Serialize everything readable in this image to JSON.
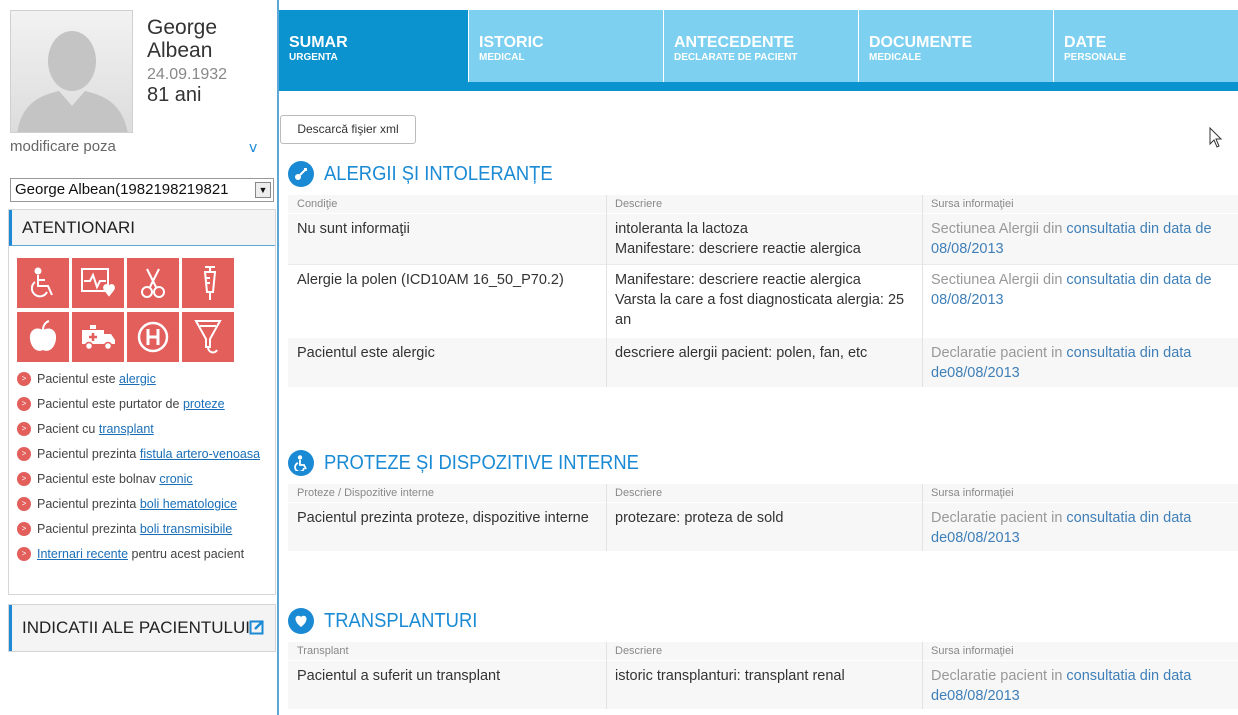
{
  "patient": {
    "name": "George Albean",
    "dob": "24.09.1932",
    "age": "81 ani",
    "photo_link": "modificare poza",
    "select_value": "George Albean(1982198219821"
  },
  "alerts": {
    "title": "ATENTIONARI",
    "tiles": [
      "wheelchair-icon",
      "heart-monitor-icon",
      "scissors-icon",
      "syringe-icon",
      "apple-icon",
      "ambulance-icon",
      "hospital-icon",
      "funnel-icon"
    ],
    "items": [
      {
        "pre": "Pacientul este ",
        "link": "alergic",
        "post": ""
      },
      {
        "pre": "Pacientul este purtator de ",
        "link": "proteze",
        "post": ""
      },
      {
        "pre": "Pacient cu ",
        "link": "transplant",
        "post": ""
      },
      {
        "pre": "Pacientul prezinta ",
        "link": "fistula artero-venoasa",
        "post": ""
      },
      {
        "pre": "Pacientul este bolnav ",
        "link": "cronic",
        "post": ""
      },
      {
        "pre": "Pacientul prezinta ",
        "link": "boli hematologice",
        "post": ""
      },
      {
        "pre": "Pacientul prezinta ",
        "link": "boli transmisibile",
        "post": ""
      },
      {
        "pre": "",
        "link": "Internari recente",
        "post": " pentru acest pacient"
      }
    ],
    "color": "#e25f5c"
  },
  "indications": {
    "title": "INDICATII ALE PACIENTULUI"
  },
  "tabs": [
    {
      "t1": "SUMAR",
      "t2": "URGENTA"
    },
    {
      "t1": "ISTORIC",
      "t2": "MEDICAL"
    },
    {
      "t1": "ANTECEDENTE",
      "t2": "DECLARATE DE PACIENT"
    },
    {
      "t1": "DOCUMENTE",
      "t2": "MEDICALE"
    },
    {
      "t1": "DATE",
      "t2": "PERSONALE"
    }
  ],
  "xml_button": "Descarcă fişier xml",
  "sections": {
    "allergies": {
      "title": "ALERGII ȘI INTOLERANȚE",
      "headers": [
        "Condiţie",
        "Descriere",
        "Sursa informaţiei"
      ],
      "rows": [
        {
          "c1": "Nu sunt informaţii",
          "c2": [
            "intoleranta la lactoza",
            "Manifestare: descriere reactie alergica"
          ],
          "src": "Sectiunea Alergii din ",
          "link": "consultatia din data de 08/08/2013"
        },
        {
          "c1": "Alergie la polen (ICD10AM 16_50_P70.2)",
          "c2": [
            "Manifestare: descriere reactie alergica",
            "Varsta la care a fost diagnosticata alergia: 25 an"
          ],
          "src": "Sectiunea Alergii din ",
          "link": "consultatia din data de 08/08/2013"
        },
        {
          "c1": "Pacientul este alergic",
          "c2": [
            "descriere alergii pacient: polen, fan, etc"
          ],
          "src": "Declaratie pacient in ",
          "link": "consultatia din data de08/08/2013"
        }
      ]
    },
    "prostheses": {
      "title": "PROTEZE ȘI DISPOZITIVE INTERNE",
      "headers": [
        "Proteze / Dispozitive interne",
        "Descriere",
        "Sursa informaţiei"
      ],
      "rows": [
        {
          "c1": "Pacientul prezinta proteze, dispozitive interne",
          "c2": [
            "protezare: proteza de sold"
          ],
          "src": "Declaratie pacient in ",
          "link": "consultatia din data de08/08/2013"
        }
      ]
    },
    "transplants": {
      "title": "TRANSPLANTURI",
      "headers": [
        "Transplant",
        "Descriere",
        "Sursa informaţiei"
      ],
      "rows": [
        {
          "c1": "Pacientul a suferit un transplant",
          "c2": [
            "istoric transplanturi: transplant renal"
          ],
          "src": "Declaratie pacient in ",
          "link": "consultatia din data de08/08/2013"
        }
      ]
    }
  },
  "colors": {
    "accent": "#1a8ad4",
    "tab_active": "#0b93cf",
    "tab_inactive": "#7dd0ef"
  }
}
